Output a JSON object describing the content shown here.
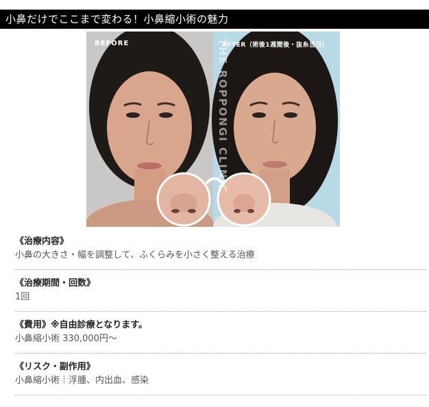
{
  "header": {
    "title": "小鼻だけでここまで変わる！小鼻縮小術の魅力"
  },
  "photo": {
    "before_label": "BEFORE",
    "after_label": "AFTER（術後1週間後・抜糸当日）",
    "watermark": "THE ROPPONGI CLINIC"
  },
  "sections": [
    {
      "title": "《治療内容》",
      "note": "",
      "body": "小鼻の大きさ・幅を調整して、ふくらみを小さく整える治療"
    },
    {
      "title": "《治療期間・回数》",
      "note": "",
      "body": "1回"
    },
    {
      "title": "《費用》",
      "note": "※自由診療となります。",
      "body": "小鼻縮小術 330,000円〜"
    },
    {
      "title": "《リスク・副作用》",
      "note": "",
      "body": "小鼻縮小術｜浮腫、内出血、感染"
    }
  ]
}
